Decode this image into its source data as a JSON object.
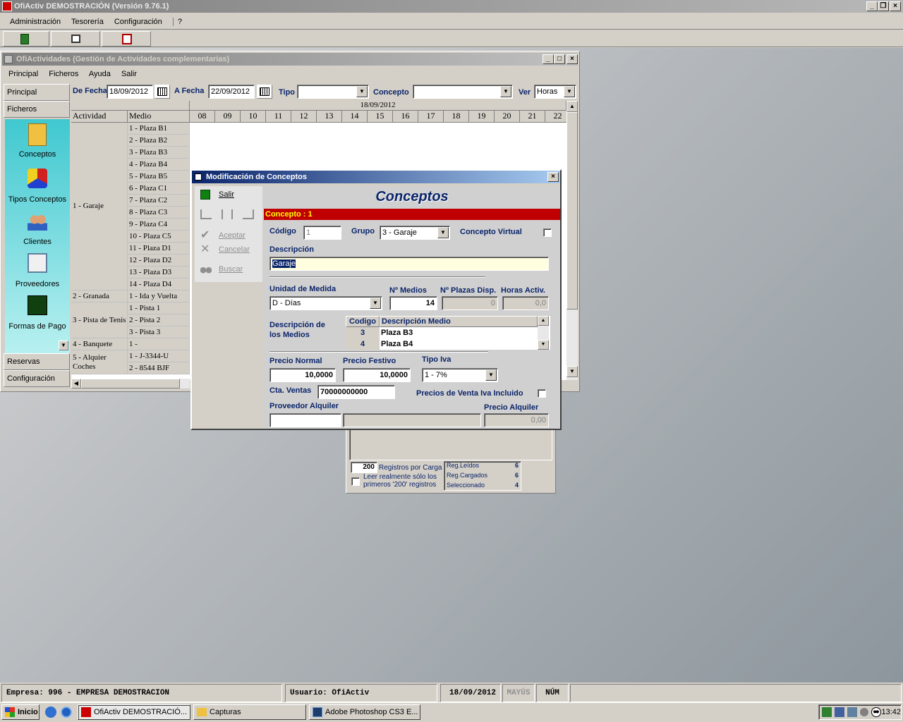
{
  "app": {
    "title": "OfiActiv DEMOSTRACIÓN (Versión 9.76.1)",
    "menu": [
      "Administración",
      "Tesorería",
      "Configuración",
      "?"
    ]
  },
  "child": {
    "title": "OfiActividades (Gestión de Actividades complementarias)",
    "menu": [
      "Principal",
      "Ficheros",
      "Ayuda",
      "Salir"
    ],
    "filters": {
      "de_fecha_label": "De Fecha",
      "de_fecha": "18/09/2012",
      "a_fecha_label": "A Fecha",
      "a_fecha": "22/09/2012",
      "tipo_label": "Tipo",
      "tipo": "",
      "concepto_label": "Concepto",
      "concepto": "",
      "ver_label": "Ver",
      "ver": "Horas"
    },
    "grid": {
      "date": "18/09/2012",
      "col_actividad": "Actividad",
      "col_medio": "Medio",
      "hours": [
        "08",
        "09",
        "10",
        "11",
        "12",
        "13",
        "14",
        "15",
        "16",
        "17",
        "18",
        "19",
        "20",
        "21",
        "22"
      ],
      "groups": [
        {
          "name": "1 - Garaje",
          "rows": 14
        },
        {
          "name": "2 - Granada",
          "rows": 1
        },
        {
          "name": "3 - Pista de Tenis",
          "rows": 3
        },
        {
          "name": "4 - Banquete",
          "rows": 1
        },
        {
          "name": "5 - Alquier Coches",
          "rows": 2
        }
      ],
      "medios": [
        "1 - Plaza B1",
        "2 - Plaza B2",
        "3 - Plaza B3",
        "4 - Plaza B4",
        "5 - Plaza B5",
        "6 - Plaza C1",
        "7 - Plaza C2",
        "8 - Plaza C3",
        "9 - Plaza C4",
        "10 - Plaza C5",
        "11 - Plaza D1",
        "12 - Plaza D2",
        "13 - Plaza D3",
        "14 - Plaza D4",
        "1 - Ida y Vuelta",
        "1 - Pista 1",
        "2 - Pista 2",
        "3 - Pista 3",
        "1 -",
        "1 - J-3344-U",
        "2 - 8544 BJF"
      ]
    },
    "sidebar": {
      "top": [
        "Principal",
        "Ficheros"
      ],
      "items": [
        "Conceptos",
        "Tipos Conceptos",
        "Clientes",
        "Proveedores",
        "Formas de Pago"
      ],
      "bottom": [
        "Reservas",
        "Configuración"
      ]
    }
  },
  "behind": {
    "registros_por_carga_value": "200",
    "registros_por_carga_label": "Registros por Carga",
    "leer_label": "Leer realmente sólo los primeros '200' registros",
    "reg_leidos_label": "Reg.Leídos",
    "reg_leidos": "6",
    "reg_cargados_label": "Reg.Cargados",
    "reg_cargados": "6",
    "seleccionado_label": "Seleccionado",
    "seleccionado": "4"
  },
  "dialog": {
    "title": "Modificación de Conceptos",
    "heading": "Conceptos",
    "banner": "Concepto : 1",
    "toolbar": {
      "salir": "Salir",
      "aceptar": "Aceptar",
      "cancelar": "Cancelar",
      "buscar": "Buscar"
    },
    "codigo_label": "Código",
    "codigo": "1",
    "grupo_label": "Grupo",
    "grupo": "3 - Garaje",
    "virtual_label": "Concepto Virtual",
    "descripcion_label": "Descripción",
    "descripcion": "Garaje",
    "unidad_label": "Unidad de Medida",
    "unidad": "D - Días",
    "n_medios_label": "Nº Medios",
    "n_medios": "14",
    "plazas_label": "Nº Plazas Disp.",
    "plazas": "0",
    "horas_label": "Horas Activ.",
    "horas": "0,0",
    "desc_medios_label": "Descripción de los Medios",
    "medios_table": {
      "col_codigo": "Codigo",
      "col_desc": "Descripción Medio",
      "rows": [
        {
          "codigo": "3",
          "desc": "Plaza B3"
        },
        {
          "codigo": "4",
          "desc": "Plaza B4"
        }
      ]
    },
    "precio_normal_label": "Precio Normal",
    "precio_normal": "10,0000",
    "precio_festivo_label": "Precio Festivo",
    "precio_festivo": "10,0000",
    "tipo_iva_label": "Tipo Iva",
    "tipo_iva": "1 - 7%",
    "cta_ventas_label": "Cta. Ventas",
    "cta_ventas": "70000000000",
    "iva_incluido_label": "Precios de Venta Iva Incluido",
    "proveedor_label": "Proveedor Alquiler",
    "proveedor_code": "",
    "proveedor_name": "",
    "precio_alquiler_label": "Precio Alquiler",
    "precio_alquiler": "0,00"
  },
  "statusbar": {
    "empresa": "Empresa: 996 - EMPRESA DEMOSTRACION",
    "usuario": "Usuario: OfiActiv",
    "fecha": "18/09/2012",
    "mayus": "MAYÚS",
    "num": "NÚM"
  },
  "taskbar": {
    "start": "Inicio",
    "tasks": [
      "OfiActiv DEMOSTRACIÓ...",
      "Capturas",
      "Adobe Photoshop CS3 E..."
    ],
    "clock": "13:42"
  },
  "colors": {
    "title_active": "#0a246a",
    "banner_red": "#c00000",
    "banner_text": "#ffff00",
    "sidebar_teal": "#44c8d0",
    "desktop": "#8a949a"
  }
}
